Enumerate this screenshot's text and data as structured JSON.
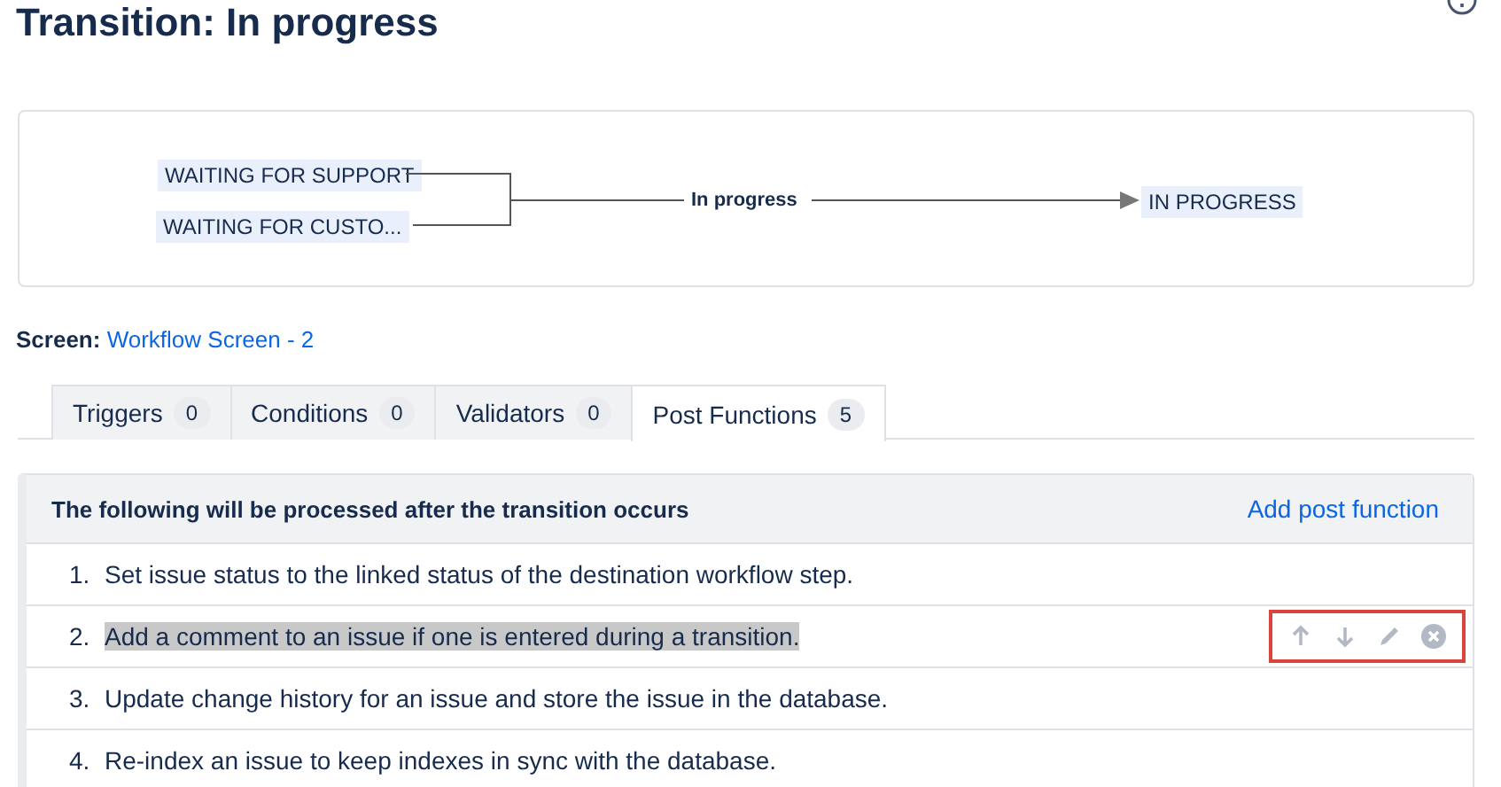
{
  "page": {
    "title": "Transition: In progress"
  },
  "diagram": {
    "sources": [
      {
        "label": "WAITING FOR SUPPORT"
      },
      {
        "label": "WAITING FOR CUSTO..."
      }
    ],
    "transition": "In progress",
    "target": "IN PROGRESS"
  },
  "screen": {
    "label": "Screen:",
    "link": "Workflow Screen - 2"
  },
  "tabs": [
    {
      "label": "Triggers",
      "count": "0",
      "selected": false
    },
    {
      "label": "Conditions",
      "count": "0",
      "selected": false
    },
    {
      "label": "Validators",
      "count": "0",
      "selected": false
    },
    {
      "label": "Post Functions",
      "count": "5",
      "selected": true
    }
  ],
  "panel": {
    "heading": "The following will be processed after the transition occurs",
    "action": "Add post function",
    "items": [
      {
        "number": "1.",
        "text": "Set issue status to the linked status of the destination workflow step.",
        "highlighted": false,
        "show_actions": false,
        "annotated": false
      },
      {
        "number": "2.",
        "text": "Add a comment to an issue if one is entered during a transition.",
        "highlighted": true,
        "show_actions": true,
        "annotated": true
      },
      {
        "number": "3.",
        "text": "Update change history for an issue and store the issue in the database.",
        "highlighted": false,
        "show_actions": false,
        "annotated": false
      },
      {
        "number": "4.",
        "text": "Re-index an issue to keep indexes in sync with the database.",
        "highlighted": false,
        "show_actions": false,
        "annotated": false
      }
    ]
  }
}
